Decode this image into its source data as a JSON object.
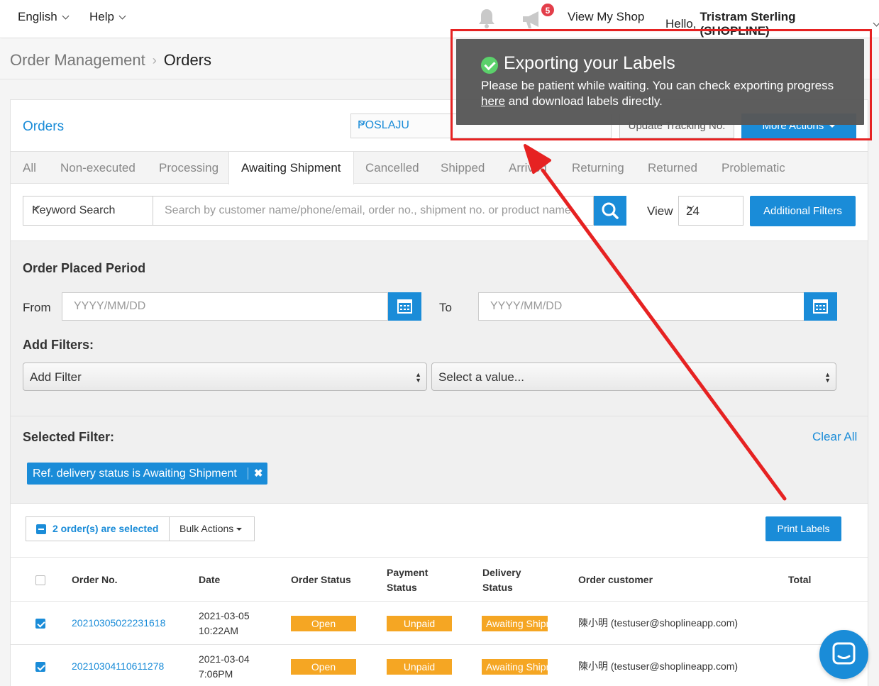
{
  "topbar": {
    "language": "English",
    "help": "Help",
    "notification_count": "5",
    "view_shop": "View My Shop",
    "greeting": "Hello,",
    "user_name": "Tristram Sterling (SHOPLINE)"
  },
  "breadcrumb": {
    "parent": "Order Management",
    "current": "Orders"
  },
  "panel": {
    "title": "Orders",
    "courier": "POSLAJU",
    "update_tracking": "Update Tracking No.",
    "more_actions": "More Actions"
  },
  "tabs": [
    "All",
    "Non-executed",
    "Processing",
    "Awaiting Shipment",
    "Cancelled",
    "Shipped",
    "Arrived",
    "Returning",
    "Returned",
    "Problematic"
  ],
  "active_tab": "Awaiting Shipment",
  "search": {
    "type": "Keyword Search",
    "placeholder": "Search by customer name/phone/email, order no., shipment no. or product name",
    "view_label": "View",
    "view_value": "24",
    "additional_filters": "Additional Filters"
  },
  "filters": {
    "period_title": "Order Placed Period",
    "from_label": "From",
    "to_label": "To",
    "date_placeholder": "YYYY/MM/DD",
    "add_filters_title": "Add Filters:",
    "add_filter": "Add Filter",
    "select_value": "Select a value...",
    "selected_title": "Selected Filter:",
    "clear_all": "Clear All",
    "chip": "Ref. delivery status is Awaiting Shipment"
  },
  "bulk": {
    "selected": "2 order(s) are selected",
    "bulk_actions": "Bulk Actions",
    "print_labels": "Print Labels"
  },
  "table": {
    "headers": {
      "order_no": "Order No.",
      "date": "Date",
      "order_status": "Order Status",
      "payment_status_1": "Payment",
      "payment_status_2": "Status",
      "delivery_status_1": "Delivery",
      "delivery_status_2": "Status",
      "customer": "Order customer",
      "total": "Total"
    },
    "rows": [
      {
        "order_no": "20210305022231618",
        "date": "2021-03-05",
        "time": "10:22AM",
        "order_status": "Open",
        "payment_status": "Unpaid",
        "delivery_status": "Awaiting Shipment",
        "customer": "陳小明 (testuser@shoplineapp.com)"
      },
      {
        "order_no": "20210304110611278",
        "date": "2021-03-04",
        "time": "7:06PM",
        "order_status": "Open",
        "payment_status": "Unpaid",
        "delivery_status": "Awaiting Shipment",
        "customer": "陳小明 (testuser@shoplineapp.com)"
      }
    ]
  },
  "toast": {
    "title": "Exporting your Labels",
    "body_before": "Please be patient while waiting. You can check exporting progress",
    "link": "here",
    "body_after": "and download labels directly."
  },
  "colors": {
    "accent": "#1a8cd8",
    "status_orange": "#f5a623",
    "annotation_red": "#e62222",
    "success_green": "#5bd16b"
  }
}
